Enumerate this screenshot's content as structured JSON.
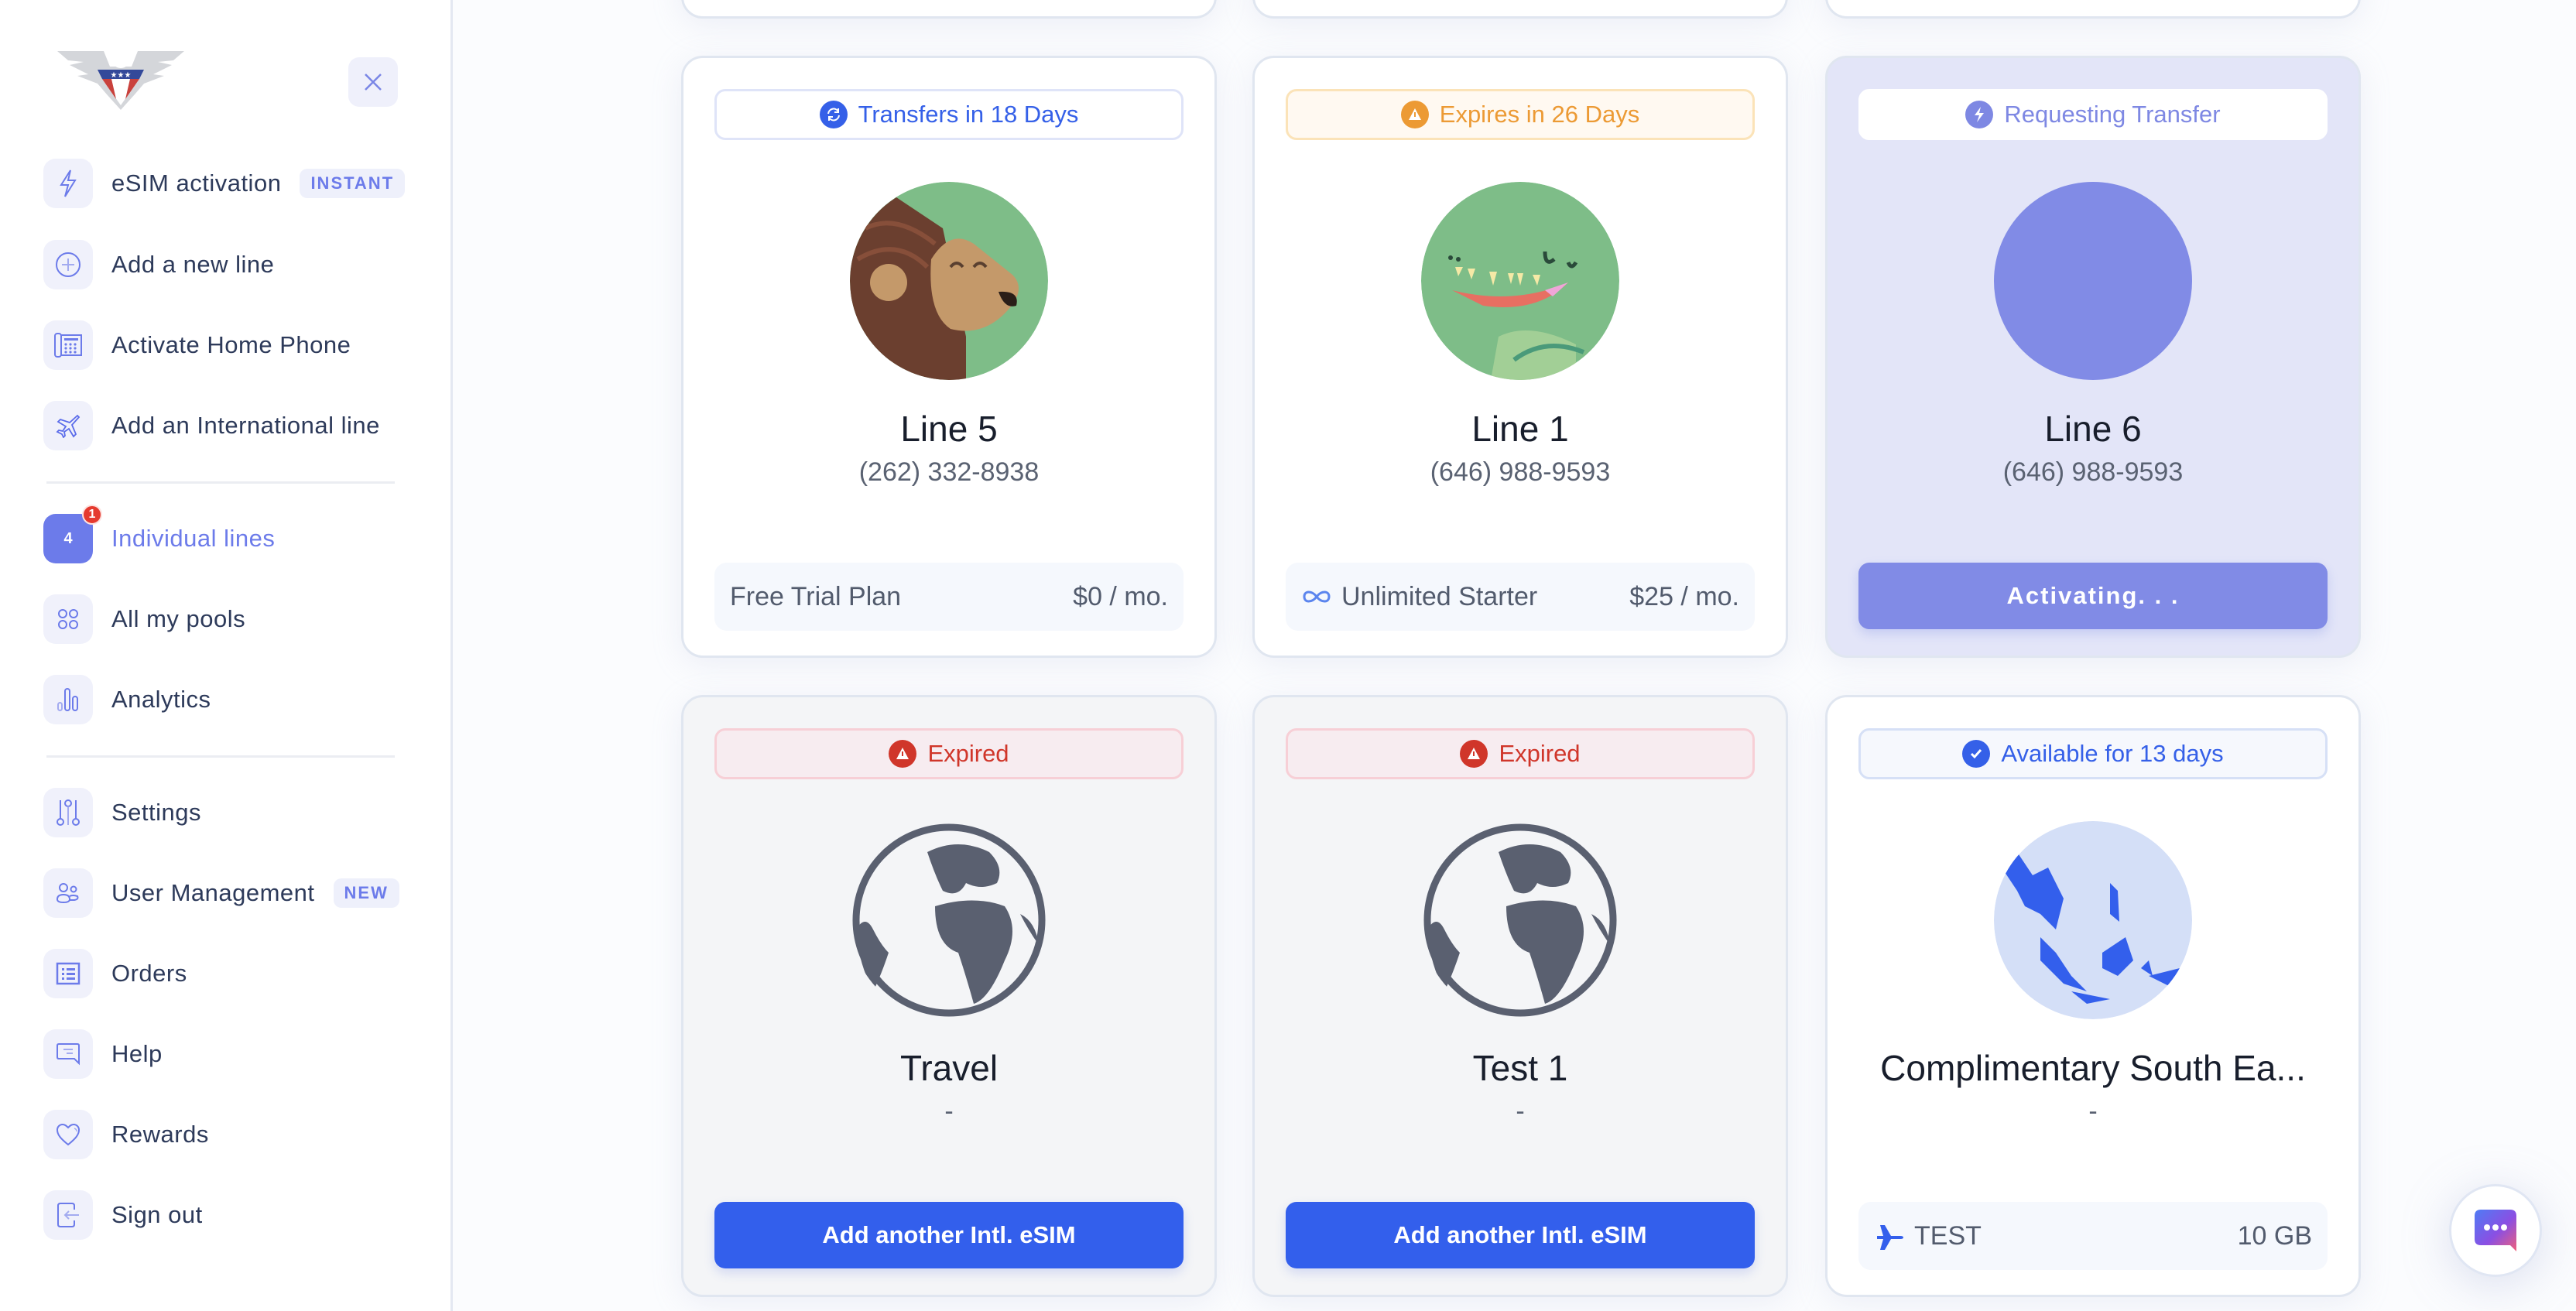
{
  "sidebar": {
    "logo": "eagle-shield-logo",
    "close_icon": "close-icon",
    "items": [
      {
        "label": "eSIM activation",
        "icon": "lightning-icon",
        "tag": "INSTANT"
      },
      {
        "label": "Add a new line",
        "icon": "plus-circle-icon"
      },
      {
        "label": "Activate Home Phone",
        "icon": "home-phone-icon"
      },
      {
        "label": "Add an International line",
        "icon": "airplane-icon"
      },
      {
        "label": "Individual lines",
        "icon_text": "4",
        "badge": "1",
        "active": true
      },
      {
        "label": "All my pools",
        "icon": "pools-icon"
      },
      {
        "label": "Analytics",
        "icon": "bar-chart-icon"
      },
      {
        "label": "Settings",
        "icon": "sliders-icon"
      },
      {
        "label": "User Management",
        "icon": "users-icon",
        "tag": "NEW"
      },
      {
        "label": "Orders",
        "icon": "list-icon"
      },
      {
        "label": "Help",
        "icon": "chat-bubble-icon"
      },
      {
        "label": "Rewards",
        "icon": "heart-icon"
      },
      {
        "label": "Sign out",
        "icon": "sign-out-icon"
      }
    ]
  },
  "cards": [
    {
      "status": "Transfers in 18 Days",
      "status_icon": "transfer-icon",
      "title": "Line 5",
      "subtitle": "(262) 332-8938",
      "plan": "Free Trial Plan",
      "price": "$0 / mo.",
      "avatar": "lion-avatar"
    },
    {
      "status": "Expires in 26 Days",
      "status_icon": "warning-icon",
      "title": "Line 1",
      "subtitle": "(646) 988-9593",
      "plan": "Unlimited Starter",
      "plan_icon": "infinity-icon",
      "price": "$25 / mo.",
      "avatar": "dinosaur-avatar"
    },
    {
      "status": "Requesting Transfer",
      "status_icon": "lightning-icon",
      "title": "Line 6",
      "subtitle": "(646) 988-9593",
      "button": "Activating. . .",
      "avatar": "placeholder-avatar"
    },
    {
      "status": "Expired",
      "status_icon": "warning-icon",
      "title": "Travel",
      "subtitle": "-",
      "button": "Add another Intl. eSIM",
      "avatar": "globe-icon"
    },
    {
      "status": "Expired",
      "status_icon": "warning-icon",
      "title": "Test 1",
      "subtitle": "-",
      "button": "Add another Intl. eSIM",
      "avatar": "globe-icon"
    },
    {
      "status": "Available for 13 days",
      "status_icon": "check-icon",
      "title": "Complimentary South Ea...",
      "subtitle": "-",
      "plan": "TEST",
      "plan_icon": "airplane-icon",
      "price": "10 GB",
      "avatar": "southeast-asia-map"
    }
  ],
  "colors": {
    "accent": "#6c7bea",
    "primary_blue": "#335fec",
    "warning_orange": "#ec9a34",
    "error_red": "#d0362a",
    "text_dark": "#2d3a5a"
  },
  "chat_fab": {
    "icon": "chat-icon"
  }
}
